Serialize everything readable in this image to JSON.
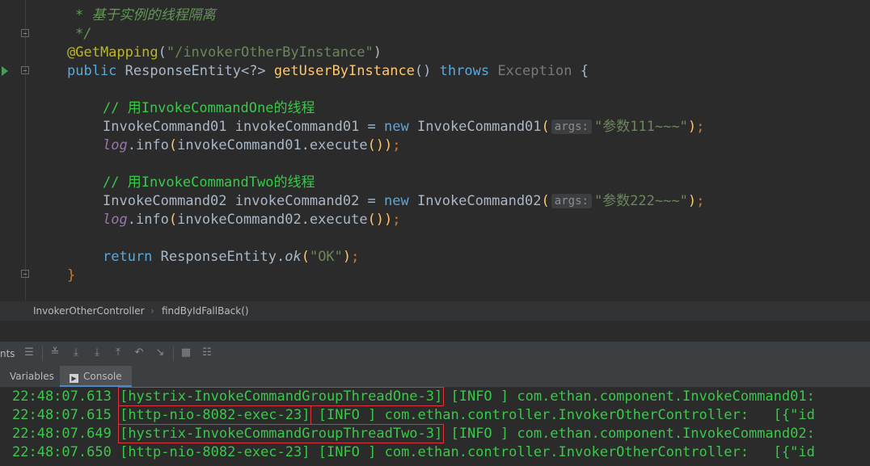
{
  "editor": {
    "lines": {
      "l1": "* 基于实例的线程隔离",
      "l2": "*/",
      "l3_ann": "@GetMapping",
      "l3_str": "\"/invokerOtherByInstance\"",
      "l4_public": "public",
      "l4_type": "ResponseEntity<?>",
      "l4_method": "getUserByInstance",
      "l4_throws": "throws",
      "l4_exc": "Exception",
      "l6_comment": "// 用InvokeCommandOne的线程",
      "l7_type": "InvokeCommand01",
      "l7_var": "invokeCommand01",
      "l7_new": "new",
      "l7_ctor": "InvokeCommand01",
      "l7_hint": "args:",
      "l7_arg": "\"参数111~~~\"",
      "l8_log": "log",
      "l8_rest": "invokeCommand01.execute",
      "l10_comment": "// 用InvokeCommandTwo的线程",
      "l11_type": "InvokeCommand02",
      "l11_var": "invokeCommand02",
      "l11_new": "new",
      "l11_ctor": "InvokeCommand02",
      "l11_hint": "args:",
      "l11_arg": "\"参数222~~~\"",
      "l12_log": "log",
      "l12_rest": "invokeCommand02.execute",
      "l14_return": "return",
      "l14_type": "ResponseEntity",
      "l14_ok": "ok",
      "l14_arg": "\"OK\"",
      "l15": "}"
    }
  },
  "breadcrumbs": {
    "class_name": "InvokerOtherController",
    "method_name": "findByIdFallBack()"
  },
  "toolbar": {
    "partial_label": "nts"
  },
  "tabs": {
    "variables": "Variables",
    "console": "Console"
  },
  "console": {
    "lines": [
      {
        "time": "22:48:07.613",
        "thread": "[hystrix-InvokeCommandGroupThreadOne-3]",
        "rest": " [INFO ] com.ethan.component.InvokeCommand01:"
      },
      {
        "time": "22:48:07.615",
        "thread": "[http-nio-8082-exec-23]",
        "rest": " [INFO ] com.ethan.controller.InvokerOtherController:   [{\"id"
      },
      {
        "time": "22:48:07.649",
        "thread": "[hystrix-InvokeCommandGroupThreadTwo-3]",
        "rest": " [INFO ] com.ethan.component.InvokeCommand02:"
      },
      {
        "time": "22:48:07.650",
        "thread": "[http-nio-8082-exec-23]",
        "rest": " [INFO ] com.ethan.controller.InvokerOtherController:   [{\"id"
      }
    ]
  },
  "colors": {
    "editor_bg": "#2b2b2b",
    "keyword": "#cc7832",
    "string": "#6a8759",
    "annotation": "#bbb529",
    "method": "#ffc66d",
    "comment": "#39c84a",
    "log_text": "#39c84a",
    "highlight_box": "#e0343a"
  }
}
